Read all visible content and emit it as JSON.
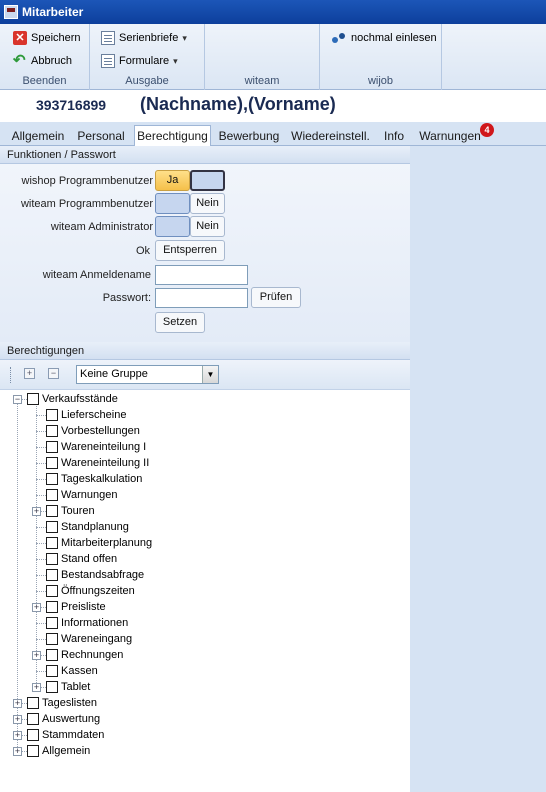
{
  "window": {
    "title": "Mitarbeiter"
  },
  "ribbon": {
    "save_label": "Speichern",
    "cancel_label": "Abbruch",
    "group_beenden": "Beenden",
    "serienbriefe_label": "Serienbriefe",
    "formulare_label": "Formulare",
    "group_ausgabe": "Ausgabe",
    "group_witeam": "witeam",
    "reload_label": "nochmal einlesen",
    "group_wijob": "wijob"
  },
  "header": {
    "number": "393716899",
    "name": "(Nachname),(Vorname)"
  },
  "tabs": [
    {
      "label": "Allgemein"
    },
    {
      "label": "Personal"
    },
    {
      "label": "Berechtigung"
    },
    {
      "label": "Bewerbung"
    },
    {
      "label": "Wiedereinstell."
    },
    {
      "label": "Info"
    },
    {
      "label": "Warnungen",
      "badge": "4"
    }
  ],
  "functions": {
    "heading": "Funktionen / Passwort",
    "wishop_label": "wishop Programmbenutzer",
    "wishop_value": "Ja",
    "witeam_label": "witeam Programmbenutzer",
    "witeam_value": "Nein",
    "admin_label": "witeam Administrator",
    "admin_value": "Nein",
    "ok_label": "Ok",
    "unlock_button": "Entsperren",
    "login_label": "witeam Anmeldename",
    "login_value": "",
    "password_label": "Passwort:",
    "password_value": "",
    "check_button": "Prüfen",
    "set_button": "Setzen"
  },
  "permissions": {
    "heading": "Berechtigungen",
    "group_select": "Keine Gruppe",
    "tree": [
      {
        "label": "Verkaufsstände",
        "level": 0,
        "expander": "minus"
      },
      {
        "label": "Lieferscheine",
        "level": 1,
        "expander": ""
      },
      {
        "label": "Vorbestellungen",
        "level": 1,
        "expander": ""
      },
      {
        "label": "Wareneinteilung I",
        "level": 1,
        "expander": ""
      },
      {
        "label": "Wareneinteilung II",
        "level": 1,
        "expander": ""
      },
      {
        "label": "Tageskalkulation",
        "level": 1,
        "expander": ""
      },
      {
        "label": "Warnungen",
        "level": 1,
        "expander": ""
      },
      {
        "label": "Touren",
        "level": 1,
        "expander": "plus"
      },
      {
        "label": "Standplanung",
        "level": 1,
        "expander": ""
      },
      {
        "label": "Mitarbeiterplanung",
        "level": 1,
        "expander": ""
      },
      {
        "label": "Stand offen",
        "level": 1,
        "expander": ""
      },
      {
        "label": "Bestandsabfrage",
        "level": 1,
        "expander": ""
      },
      {
        "label": "Öffnungszeiten",
        "level": 1,
        "expander": ""
      },
      {
        "label": "Preisliste",
        "level": 1,
        "expander": "plus"
      },
      {
        "label": "Informationen",
        "level": 1,
        "expander": ""
      },
      {
        "label": "Wareneingang",
        "level": 1,
        "expander": ""
      },
      {
        "label": "Rechnungen",
        "level": 1,
        "expander": "plus"
      },
      {
        "label": "Kassen",
        "level": 1,
        "expander": ""
      },
      {
        "label": "Tablet",
        "level": 1,
        "expander": "plus"
      },
      {
        "label": "Tageslisten",
        "level": 0,
        "expander": "plus"
      },
      {
        "label": "Auswertung",
        "level": 0,
        "expander": "plus"
      },
      {
        "label": "Stammdaten",
        "level": 0,
        "expander": "plus"
      },
      {
        "label": "Allgemein",
        "level": 0,
        "expander": "plus"
      }
    ]
  }
}
